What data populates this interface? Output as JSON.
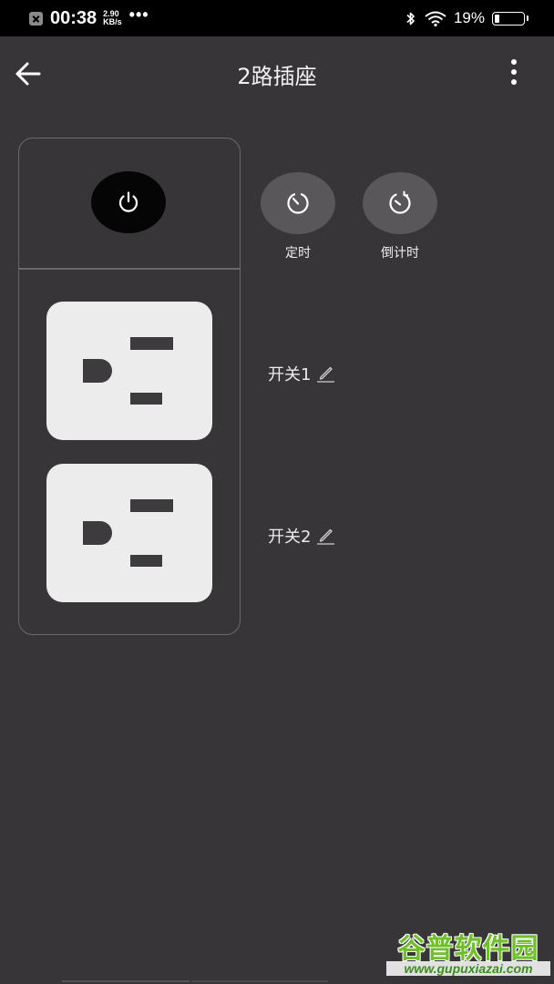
{
  "status_bar": {
    "time": "00:38",
    "net_speed_value": "2.90",
    "net_speed_unit": "KB/s",
    "more_dots": "•••",
    "battery_percent": "19%",
    "battery_level": 0.19,
    "icons": [
      "notification-icon",
      "bluetooth-icon",
      "wifi-icon",
      "battery-icon"
    ]
  },
  "header": {
    "title": "2路插座",
    "back_icon": "arrow-left-icon",
    "more_icon": "more-vertical-icon"
  },
  "device": {
    "master_power_icon": "power-icon",
    "sockets": [
      {
        "icon": "outlet-icon"
      },
      {
        "icon": "outlet-icon"
      }
    ]
  },
  "actions": [
    {
      "label": "定时",
      "icon": "timer-icon"
    },
    {
      "label": "倒计时",
      "icon": "countdown-icon"
    }
  ],
  "switches": [
    {
      "name": "开关1",
      "icon": "edit-icon"
    },
    {
      "name": "开关2",
      "icon": "edit-icon"
    }
  ],
  "watermark": {
    "title": "谷普软件园",
    "url": "www.gupuxiazai.com"
  },
  "colors": {
    "background": "#383538",
    "panel_border": "#6b686b",
    "socket_face": "#ececec",
    "socket_pin": "#3e3b3e",
    "action_button": "#5a575a",
    "power_button": "#050505"
  }
}
